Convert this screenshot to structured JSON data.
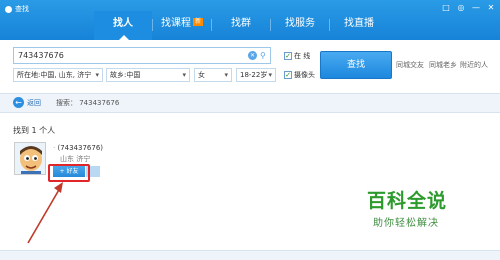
{
  "window": {
    "title": "查找",
    "controls": [
      "□",
      "◎",
      "—",
      "✕"
    ]
  },
  "tabs": [
    {
      "label": "找人",
      "active": true,
      "badge": ""
    },
    {
      "label": "找课程",
      "active": false,
      "badge": "新"
    },
    {
      "label": "找群",
      "active": false,
      "badge": ""
    },
    {
      "label": "找服务",
      "active": false,
      "badge": ""
    },
    {
      "label": "找直播",
      "active": false,
      "badge": ""
    }
  ],
  "search": {
    "value": "743437676",
    "online_label": "在 线",
    "camera_label": "摄像头",
    "find_label": "查找",
    "link_same_city": "同城交友",
    "link_hometown": "同城老乡",
    "link_nearby": "附近的人"
  },
  "filters": {
    "location": "所在地:中国, 山东, 济宁",
    "hometown": "故乡:中国",
    "gender": "女",
    "age": "18-22岁"
  },
  "nav": {
    "back_label": "返回",
    "breadcrumb": "搜索： 743437676"
  },
  "results": {
    "count_text": "找到 1 个人",
    "items": [
      {
        "name": "(743437676)",
        "location": "山东 济宁",
        "add_label": "+ 好友"
      }
    ]
  },
  "watermark": {
    "title": "百科全说",
    "subtitle": "助你轻松解决"
  }
}
